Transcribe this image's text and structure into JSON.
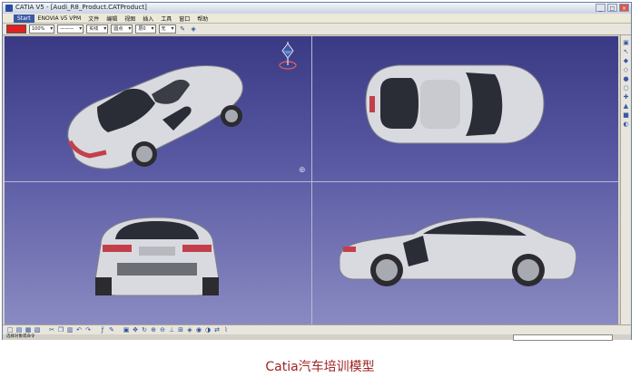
{
  "window": {
    "title": "CATIA V5 - [Audi_R8_Product.CATProduct]",
    "buttons": [
      "_",
      "□",
      "×"
    ]
  },
  "menubar": {
    "start": "Start",
    "items": [
      "ENOVIA V5 VPM",
      "文件",
      "编辑",
      "视图",
      "插入",
      "工具",
      "窗口",
      "帮助"
    ]
  },
  "toolbar": {
    "color": "#e02020",
    "transparency": "100%",
    "line_thickness": "———",
    "linetype": "实线",
    "point_symbol": "圆点",
    "layer_label": "层0",
    "rendering": "无"
  },
  "status": {
    "prompt": "选择对象或命令"
  },
  "caption": "Catia汽车培训模型",
  "colors": {
    "viewport_top": "#3a3a84",
    "viewport_bottom": "#8a8ac2",
    "car_body": "#d9dadf",
    "glass": "#2a2d36",
    "taillight": "#c2404a"
  },
  "icons": {
    "compass": "compass-icon",
    "axis": "axis-icon"
  }
}
